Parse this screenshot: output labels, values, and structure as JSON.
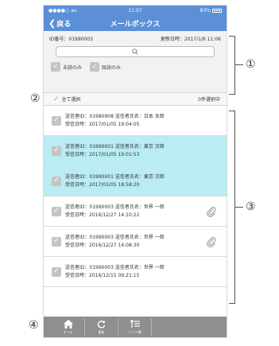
{
  "status": {
    "carrier": "●●●●○ au",
    "time": "11:07",
    "battery": "83%"
  },
  "nav": {
    "back_label": "戻る",
    "title": "メールボックス"
  },
  "filter": {
    "id_text": "ID番号：01990003",
    "updated_text": "更新日時：2017/1/6 11:06",
    "search_placeholder": "",
    "unread_label": "未読のみ",
    "read_label": "既読のみ"
  },
  "select": {
    "all_label": "全て選択",
    "count_label": "0件選択中"
  },
  "messages": [
    {
      "line1": "送信者ID：01980908  送信者氏名：日本 太郎",
      "line2": "受信日時：2017/01/05 19:04:05",
      "selected": false,
      "attachment": false
    },
    {
      "line1": "送信者ID：01990001  送信者氏名：東京 次郎",
      "line2": "受信日時：2017/01/05 19:01:53",
      "selected": true,
      "attachment": false
    },
    {
      "line1": "送信者ID：01990001  送信者氏名：東京 次郎",
      "line2": "受信日時：2017/01/05 18:58:20",
      "selected": true,
      "attachment": false
    },
    {
      "line1": "送信者ID：01990003  送信者氏名：世界 一郎",
      "line2": "受信日時：2016/12/27 14:10:22",
      "selected": false,
      "attachment": true
    },
    {
      "line1": "送信者ID：01990003  送信者氏名：世界 一郎",
      "line2": "受信日時：2016/12/27 14:08:30",
      "selected": false,
      "attachment": true
    },
    {
      "line1": "送信者ID：01990003  送信者氏名：世界 一郎",
      "line2": "受信日時：2016/12/15 09:21:15",
      "selected": false,
      "attachment": false
    }
  ],
  "tabs": [
    {
      "label": "ホーム",
      "icon": "home-icon"
    },
    {
      "label": "更新",
      "icon": "refresh-icon"
    },
    {
      "label": "ソート順",
      "icon": "sort-icon"
    }
  ],
  "markers": {
    "m1": "①",
    "m2": "②",
    "m3": "③",
    "m4": "④"
  },
  "colors": {
    "header": "#5b8fd6",
    "selected_row": "#b9ecf3",
    "tabbar": "#8f8f8f"
  }
}
